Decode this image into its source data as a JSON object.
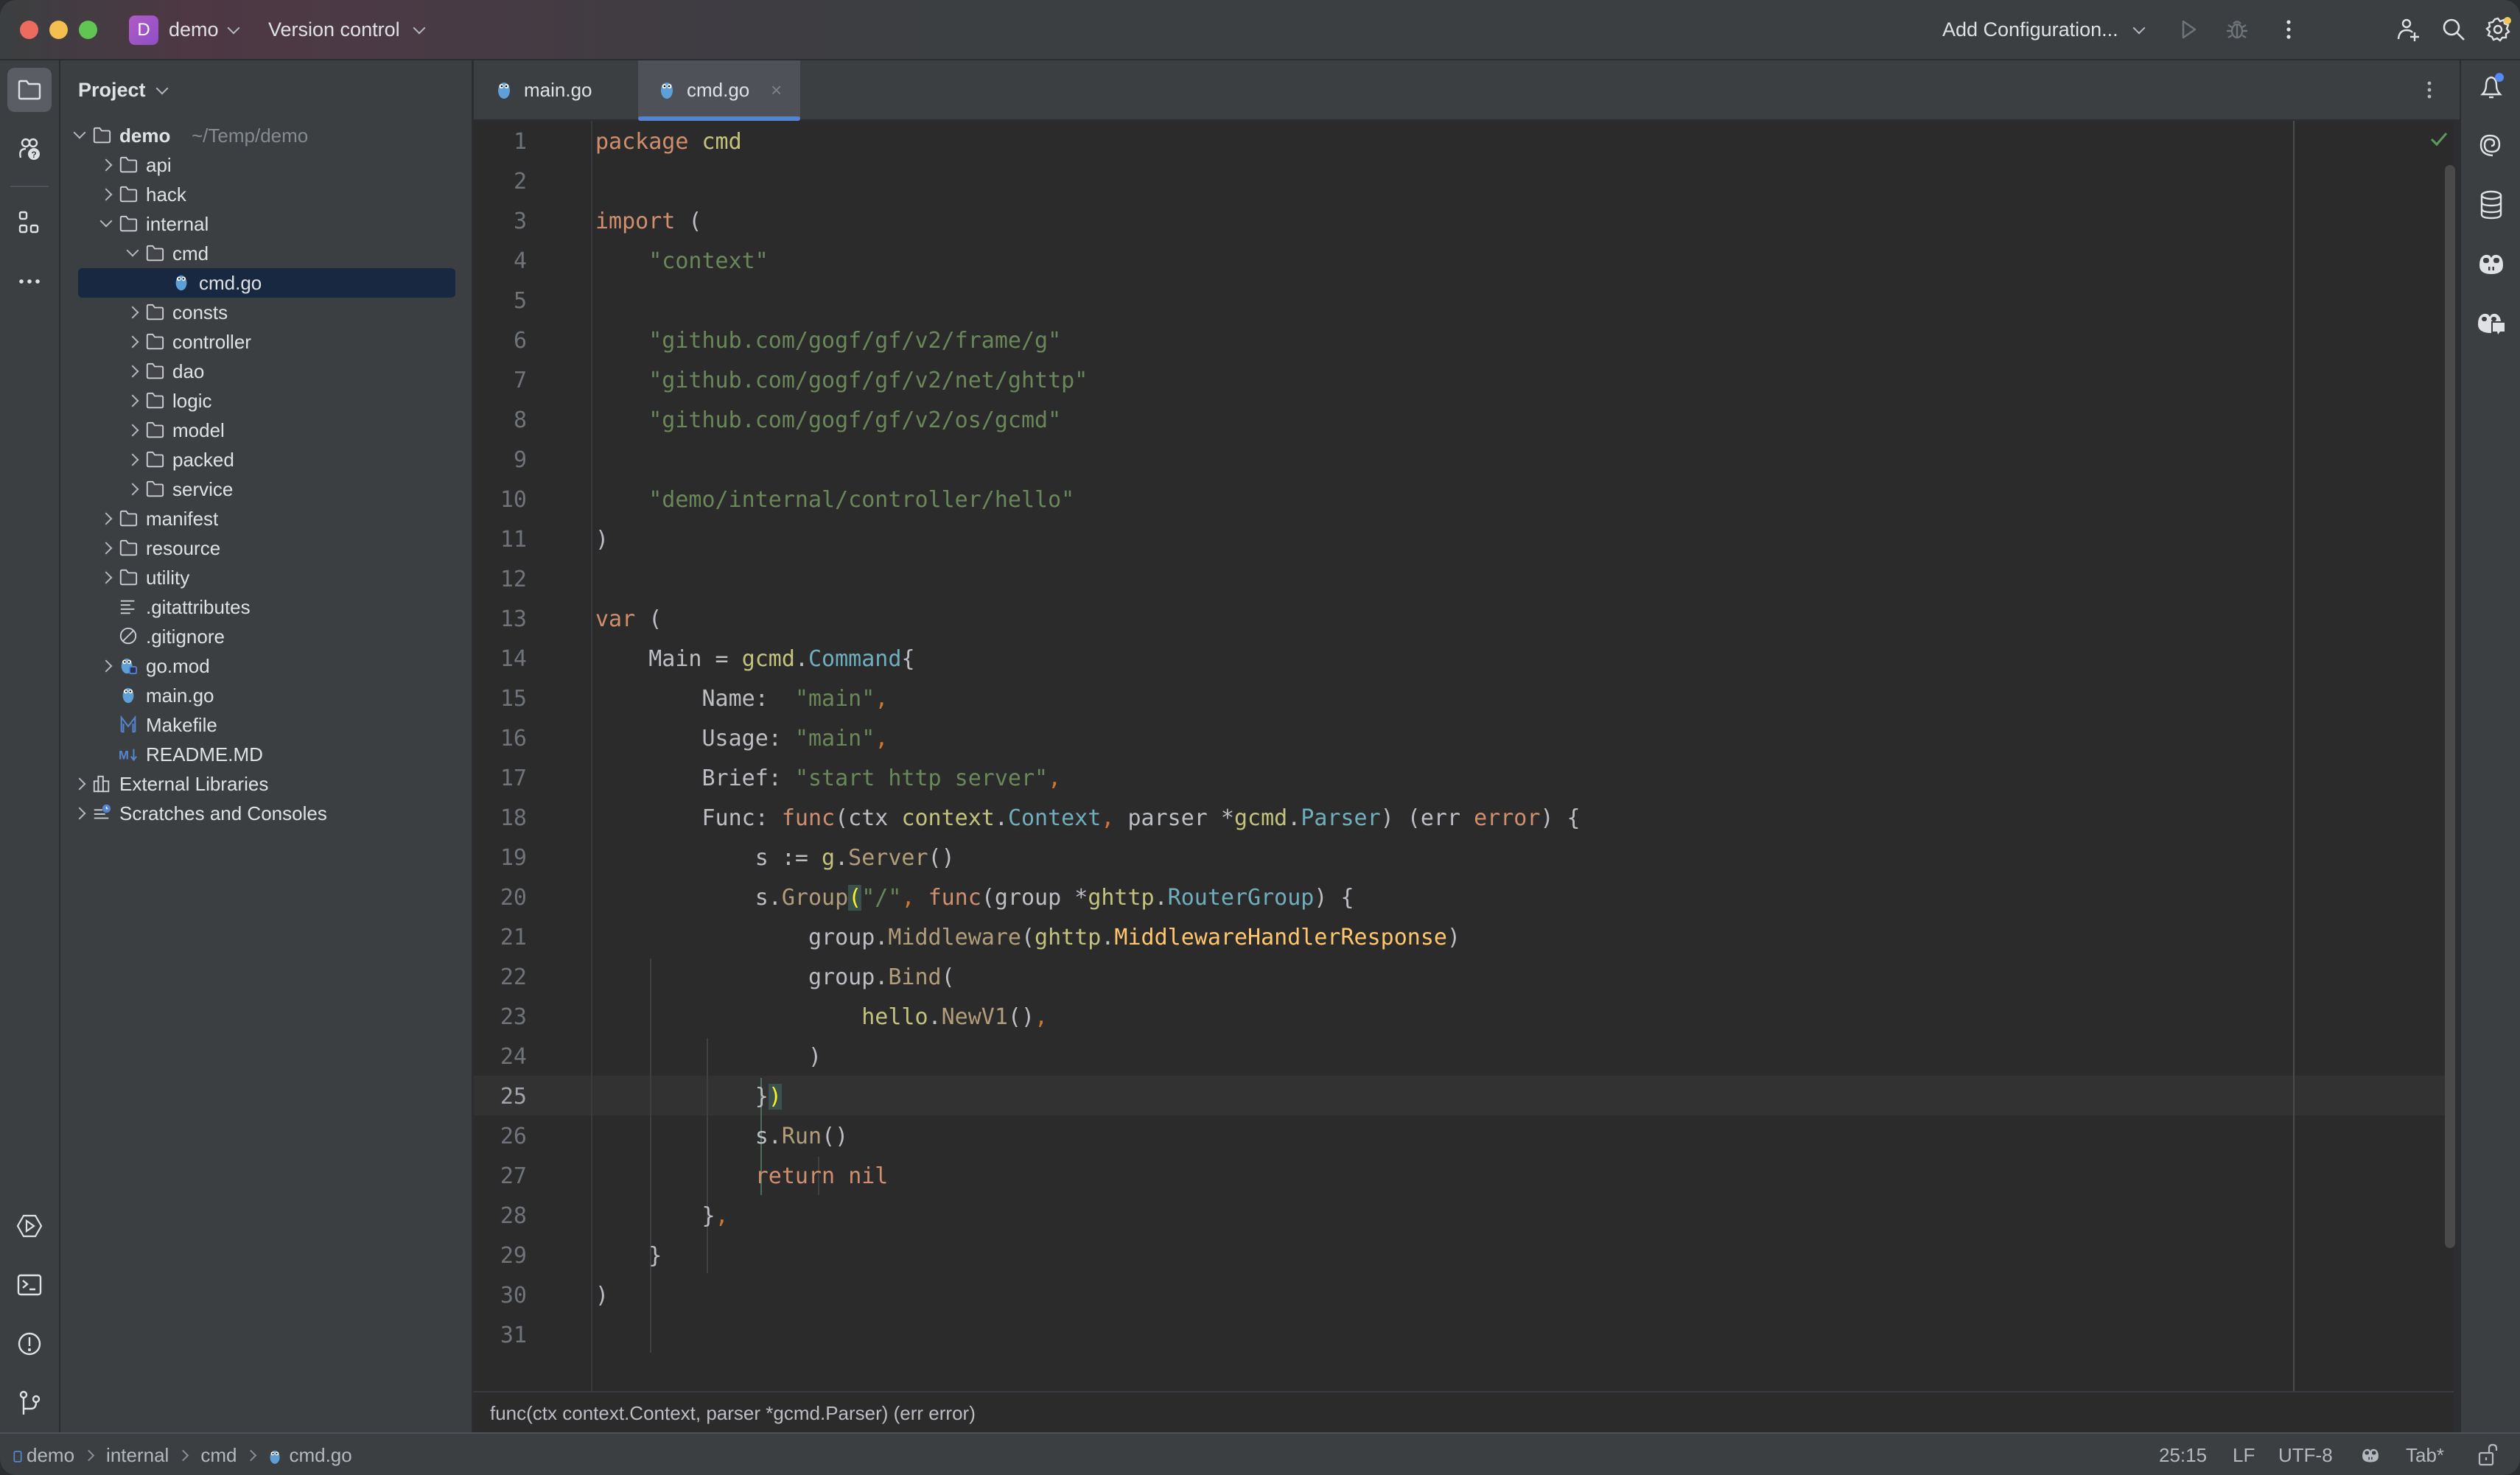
{
  "titlebar": {
    "project_badge": "D",
    "project_name": "demo",
    "vcs_label": "Version control",
    "run_config_label": "Add Configuration..."
  },
  "project_panel": {
    "title": "Project",
    "tree": [
      {
        "label": "demo",
        "hint": "~/Temp/demo",
        "depth": 0,
        "type": "folder",
        "expanded": true,
        "bold": true
      },
      {
        "label": "api",
        "depth": 1,
        "type": "folder",
        "expanded": false
      },
      {
        "label": "hack",
        "depth": 1,
        "type": "folder",
        "expanded": false
      },
      {
        "label": "internal",
        "depth": 1,
        "type": "folder",
        "expanded": true
      },
      {
        "label": "cmd",
        "depth": 2,
        "type": "folder",
        "expanded": true
      },
      {
        "label": "cmd.go",
        "depth": 3,
        "type": "go",
        "selected": true
      },
      {
        "label": "consts",
        "depth": 2,
        "type": "folder",
        "expanded": false
      },
      {
        "label": "controller",
        "depth": 2,
        "type": "folder",
        "expanded": false
      },
      {
        "label": "dao",
        "depth": 2,
        "type": "folder",
        "expanded": false
      },
      {
        "label": "logic",
        "depth": 2,
        "type": "folder",
        "expanded": false
      },
      {
        "label": "model",
        "depth": 2,
        "type": "folder",
        "expanded": false
      },
      {
        "label": "packed",
        "depth": 2,
        "type": "folder",
        "expanded": false
      },
      {
        "label": "service",
        "depth": 2,
        "type": "folder",
        "expanded": false
      },
      {
        "label": "manifest",
        "depth": 1,
        "type": "folder",
        "expanded": false
      },
      {
        "label": "resource",
        "depth": 1,
        "type": "folder",
        "expanded": false
      },
      {
        "label": "utility",
        "depth": 1,
        "type": "folder",
        "expanded": false
      },
      {
        "label": ".gitattributes",
        "depth": 1,
        "type": "text"
      },
      {
        "label": ".gitignore",
        "depth": 1,
        "type": "ignore"
      },
      {
        "label": "go.mod",
        "depth": 1,
        "type": "gomod",
        "expanded": false
      },
      {
        "label": "main.go",
        "depth": 1,
        "type": "go"
      },
      {
        "label": "Makefile",
        "depth": 1,
        "type": "makefile"
      },
      {
        "label": "README.MD",
        "depth": 1,
        "type": "markdown"
      },
      {
        "label": "External Libraries",
        "depth": 0,
        "type": "libraries",
        "expanded": false
      },
      {
        "label": "Scratches and Consoles",
        "depth": 0,
        "type": "scratches",
        "expanded": false
      }
    ]
  },
  "tabs": [
    {
      "label": "main.go",
      "active": false
    },
    {
      "label": "cmd.go",
      "active": true,
      "close": "×"
    }
  ],
  "editor": {
    "caret_line": 25,
    "lines": [
      [
        [
          "k",
          "package"
        ],
        [
          "id",
          " "
        ],
        [
          "pk",
          "cmd"
        ]
      ],
      [],
      [
        [
          "k",
          "import"
        ],
        [
          "id",
          " ("
        ]
      ],
      [
        [
          "id",
          "    "
        ],
        [
          "s",
          "\"context\""
        ]
      ],
      [],
      [
        [
          "id",
          "    "
        ],
        [
          "s",
          "\"github.com/gogf/gf/v2/frame/g\""
        ]
      ],
      [
        [
          "id",
          "    "
        ],
        [
          "s",
          "\"github.com/gogf/gf/v2/net/ghttp\""
        ]
      ],
      [
        [
          "id",
          "    "
        ],
        [
          "s",
          "\"github.com/gogf/gf/v2/os/gcmd\""
        ]
      ],
      [],
      [
        [
          "id",
          "    "
        ],
        [
          "s",
          "\"demo/internal/controller/hello\""
        ]
      ],
      [
        [
          "id",
          ")"
        ]
      ],
      [],
      [
        [
          "k",
          "var"
        ],
        [
          "id",
          " ("
        ]
      ],
      [
        [
          "id",
          "    Main = "
        ],
        [
          "pk",
          "gcmd"
        ],
        [
          "id",
          "."
        ],
        [
          "ty",
          "Command"
        ],
        [
          "id",
          "{"
        ]
      ],
      [
        [
          "id",
          "        Name:  "
        ],
        [
          "s",
          "\"main\""
        ],
        [
          "punc",
          ","
        ]
      ],
      [
        [
          "id",
          "        Usage: "
        ],
        [
          "s",
          "\"main\""
        ],
        [
          "punc",
          ","
        ]
      ],
      [
        [
          "id",
          "        Brief: "
        ],
        [
          "s",
          "\"start http server\""
        ],
        [
          "punc",
          ","
        ]
      ],
      [
        [
          "id",
          "        Func: "
        ],
        [
          "k",
          "func"
        ],
        [
          "id",
          "(ctx "
        ],
        [
          "pk",
          "context"
        ],
        [
          "id",
          "."
        ],
        [
          "ty",
          "Context"
        ],
        [
          "punc",
          ","
        ],
        [
          "id",
          " parser *"
        ],
        [
          "pk",
          "gcmd"
        ],
        [
          "id",
          "."
        ],
        [
          "ty",
          "Parser"
        ],
        [
          "id",
          ") (err "
        ],
        [
          "k",
          "error"
        ],
        [
          "id",
          ") {"
        ]
      ],
      [
        [
          "id",
          "            s := "
        ],
        [
          "pk",
          "g"
        ],
        [
          "id",
          "."
        ],
        [
          "fn",
          "Server"
        ],
        [
          "id",
          "()"
        ]
      ],
      [
        [
          "id",
          "            s."
        ],
        [
          "fn",
          "Group"
        ],
        [
          "hl",
          "("
        ],
        [
          "s",
          "\"/\""
        ],
        [
          "punc",
          ","
        ],
        [
          "id",
          " "
        ],
        [
          "k",
          "func"
        ],
        [
          "id",
          "(group *"
        ],
        [
          "pk",
          "ghttp"
        ],
        [
          "id",
          "."
        ],
        [
          "ty",
          "RouterGroup"
        ],
        [
          "id",
          ") {"
        ]
      ],
      [
        [
          "id",
          "                group."
        ],
        [
          "fn",
          "Middleware"
        ],
        [
          "id",
          "("
        ],
        [
          "pk",
          "ghttp"
        ],
        [
          "id",
          "."
        ],
        [
          "cst",
          "MiddlewareHandlerResponse"
        ],
        [
          "id",
          ")"
        ]
      ],
      [
        [
          "id",
          "                group."
        ],
        [
          "fn",
          "Bind"
        ],
        [
          "id",
          "("
        ]
      ],
      [
        [
          "id",
          "                    "
        ],
        [
          "pk",
          "hello"
        ],
        [
          "id",
          "."
        ],
        [
          "fn",
          "NewV1"
        ],
        [
          "id",
          "()"
        ],
        [
          "punc",
          ","
        ]
      ],
      [
        [
          "id",
          "                )"
        ]
      ],
      [
        [
          "id",
          "            }"
        ],
        [
          "hl",
          ")"
        ]
      ],
      [
        [
          "id",
          "            s."
        ],
        [
          "fn",
          "Run"
        ],
        [
          "id",
          "()"
        ]
      ],
      [
        [
          "id",
          "            "
        ],
        [
          "k",
          "return"
        ],
        [
          "id",
          " "
        ],
        [
          "k",
          "nil"
        ]
      ],
      [
        [
          "id",
          "        }"
        ],
        [
          "punc",
          ","
        ]
      ],
      [
        [
          "id",
          "    }"
        ]
      ],
      [
        [
          "id",
          ")"
        ]
      ],
      []
    ]
  },
  "infobar": {
    "signature": "func(ctx context.Context, parser *gcmd.Parser) (err error)"
  },
  "statusbar": {
    "breadcrumbs": [
      "demo",
      "internal",
      "cmd",
      "cmd.go"
    ],
    "position": "25:15",
    "line_separator": "LF",
    "encoding": "UTF-8",
    "indent": "Tab*"
  },
  "colors": {
    "accent": "#5585d0",
    "keyword": "#cf8e6d",
    "string": "#6a8759",
    "type": "#6fafbd",
    "package": "#c3c37e",
    "constant": "#ffc66d",
    "selection": "#172840",
    "ok_check": "#5c9a5c",
    "notification_dot": "#548af7",
    "settings_dot": "#f2c55c"
  }
}
